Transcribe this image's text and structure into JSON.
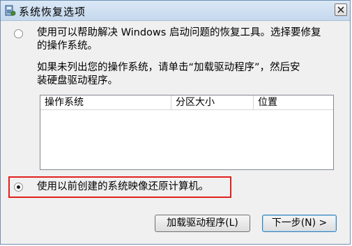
{
  "window": {
    "title": "系统恢复选项",
    "close_icon": "close-icon",
    "app_icon": "system-recovery-icon"
  },
  "option1": {
    "line1": "使用可以帮助解决 Windows 启动问题的恢复工具。选择要修复",
    "line2": "的操作系统。",
    "selected": false
  },
  "instructions": {
    "line1": "如果未列出您的操作系统，请单击“加载驱动程序”，然后安",
    "line2": "装硬盘驱动程序。"
  },
  "os_list": {
    "columns": [
      "操作系统",
      "分区大小",
      "位置"
    ],
    "rows": []
  },
  "option2": {
    "label": "使用以前创建的系统映像还原计算机。",
    "selected": true
  },
  "buttons": {
    "load_driver": "加载驱动程序(L)",
    "next": "下一步(N) >"
  },
  "colors": {
    "highlight": "#e0201c",
    "title_bar": "#c6d8ee"
  }
}
